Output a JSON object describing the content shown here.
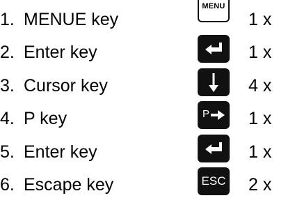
{
  "steps": [
    {
      "number": "1.",
      "label": "MENUE key",
      "key_text": "MENU",
      "key_icon": "menu-key",
      "count": "1 x"
    },
    {
      "number": "2.",
      "label": "Enter key",
      "key_icon": "enter-arrow-icon",
      "count": "1 x"
    },
    {
      "number": "3.",
      "label": "Cursor key",
      "key_icon": "down-arrow-icon",
      "count": "4 x"
    },
    {
      "number": "4.",
      "label": "P key",
      "key_text": "P",
      "key_icon": "p-right-arrow-icon",
      "count": "1 x"
    },
    {
      "number": "5.",
      "label": "Enter key",
      "key_icon": "enter-arrow-icon",
      "count": "1 x"
    },
    {
      "number": "6.",
      "label": "Escape key",
      "key_text": "ESC",
      "key_icon": "esc-key",
      "count": "2 x"
    }
  ],
  "colors": {
    "key_fill": "#111111",
    "key_glyph": "#ffffff",
    "text": "#000000",
    "background": "#ffffff"
  }
}
